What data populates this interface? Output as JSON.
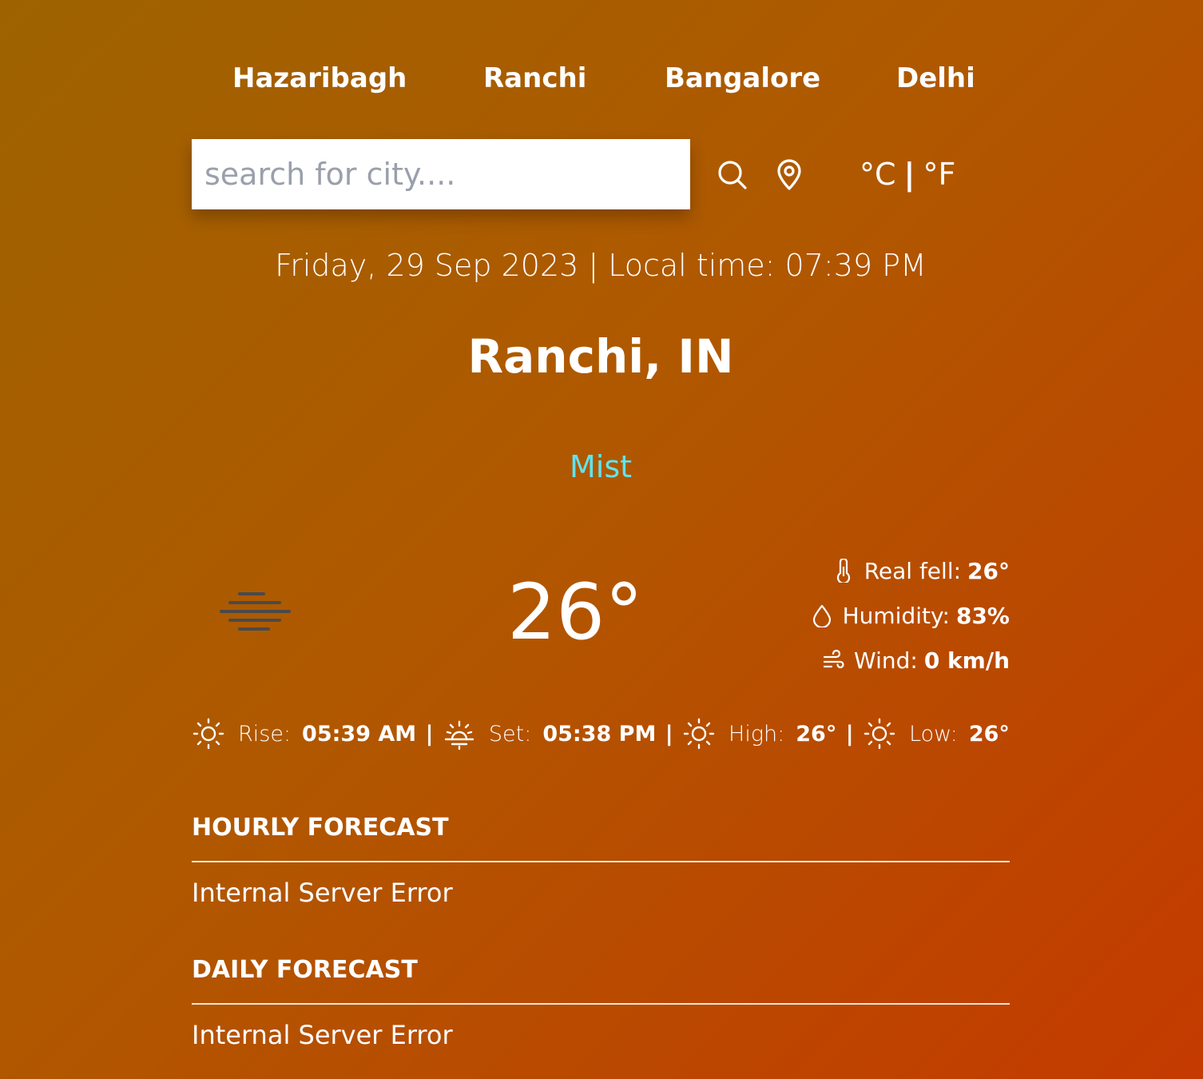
{
  "cities": [
    "Hazaribagh",
    "Ranchi",
    "Bangalore",
    "Delhi"
  ],
  "search": {
    "placeholder": "search for city....",
    "value": ""
  },
  "icons": {
    "search": "search-icon",
    "location": "location-pin-icon",
    "mist": "mist-icon",
    "thermometer": "thermometer-icon",
    "humidity": "droplet-icon",
    "wind": "wind-icon",
    "sunrise": "sun-icon",
    "sunset": "sunset-icon"
  },
  "units": {
    "celsius": "°C",
    "separator": "|",
    "fahrenheit": "°F"
  },
  "current": {
    "date_line": "Friday, 29 Sep 2023 | Local time: 07:39 PM",
    "location": "Ranchi, IN",
    "condition": "Mist",
    "temperature": "26°",
    "details": {
      "real_feel_label": "Real fell:",
      "real_feel_value": "26°",
      "humidity_label": "Humidity:",
      "humidity_value": "83%",
      "wind_label": "Wind:",
      "wind_value": "0 km/h"
    },
    "sun": {
      "rise_label": "Rise:",
      "rise_value": "05:39 AM",
      "set_label": "Set:",
      "set_value": "05:38 PM",
      "high_label": "High:",
      "high_value": "26°",
      "low_label": "Low:",
      "low_value": "26°",
      "separator": "|"
    }
  },
  "forecast": {
    "hourly_title": "HOURLY FORECAST",
    "hourly_message": "Internal Server Error",
    "daily_title": "DAILY FORECAST",
    "daily_message": "Internal Server Error"
  },
  "colors": {
    "condition": "#5ee4f0",
    "gradient_start": "#9e6300",
    "gradient_end": "#c43a00"
  }
}
